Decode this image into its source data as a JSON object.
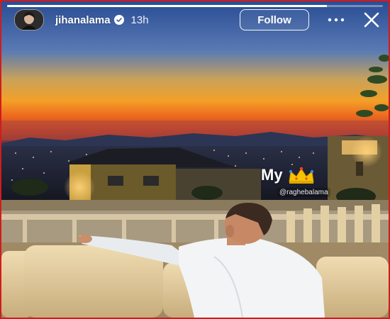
{
  "story": {
    "progress_fraction": 0.85,
    "username": "jihanalama",
    "verified": true,
    "posted_ago": "13h",
    "follow_label": "Follow",
    "sticker_text": "My",
    "sticker_emoji": "crown-icon",
    "mention": "@raghebalama"
  },
  "icons": {
    "verified": "verified-badge-icon",
    "more": "more-options-icon",
    "close": "close-icon"
  },
  "colors": {
    "frame_border": "#d01c1c",
    "sunset_orange": "#f08a24",
    "sky_blue": "#2a4a8a"
  }
}
